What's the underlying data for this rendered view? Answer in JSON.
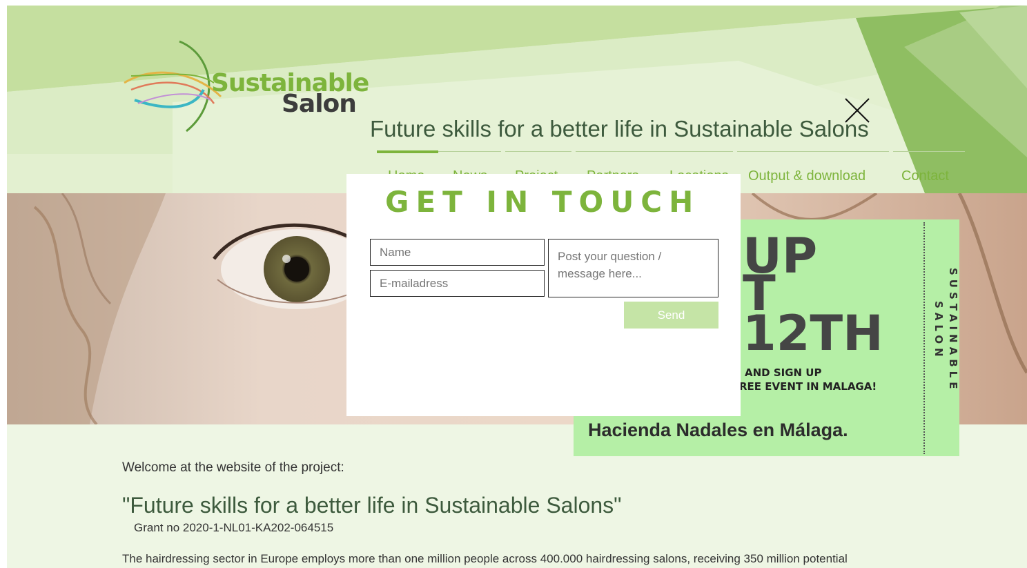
{
  "site": {
    "logo_line1": "Sustainable",
    "logo_line2": "Salon",
    "title": "Future skills for a better life in Sustainable Salons"
  },
  "nav": {
    "items": [
      {
        "label": "Home"
      },
      {
        "label": "News"
      },
      {
        "label": "Project"
      },
      {
        "label": "Partners"
      },
      {
        "label": "Locations"
      },
      {
        "label": "Output & download"
      },
      {
        "label": "Contact"
      }
    ],
    "active_index": 0
  },
  "promo": {
    "line1": "UP",
    "line2": "T",
    "line3": "12TH",
    "small1": "AND SIGN UP",
    "small2": "REE EVENT IN MALAGA!",
    "location": "Hacienda Nadales en Málaga.",
    "vertical1": "SUSTAINABLE",
    "vertical2": "SALON"
  },
  "content": {
    "welcome": "Welcome at the website of the project:",
    "project_title": "\"Future skills for a better life in Sustainable Salons\"",
    "grant": "Grant no 2020-1-NL01-KA202-064515",
    "intro": "The hairdressing sector in Europe employs more than one million people across 400.000 hairdressing salons, receiving 350 million potential"
  },
  "modal": {
    "title": "GET IN TOUCH",
    "name_placeholder": "Name",
    "email_placeholder": "E-mailadress",
    "message_placeholder": "Post your question / message here...",
    "send_label": "Send",
    "close_icon": "close-icon"
  },
  "colors": {
    "brand_green": "#7db43c",
    "header_light": "#c5df9f",
    "promo_bg": "#b5efa6",
    "send_button": "#c5e4a6"
  }
}
